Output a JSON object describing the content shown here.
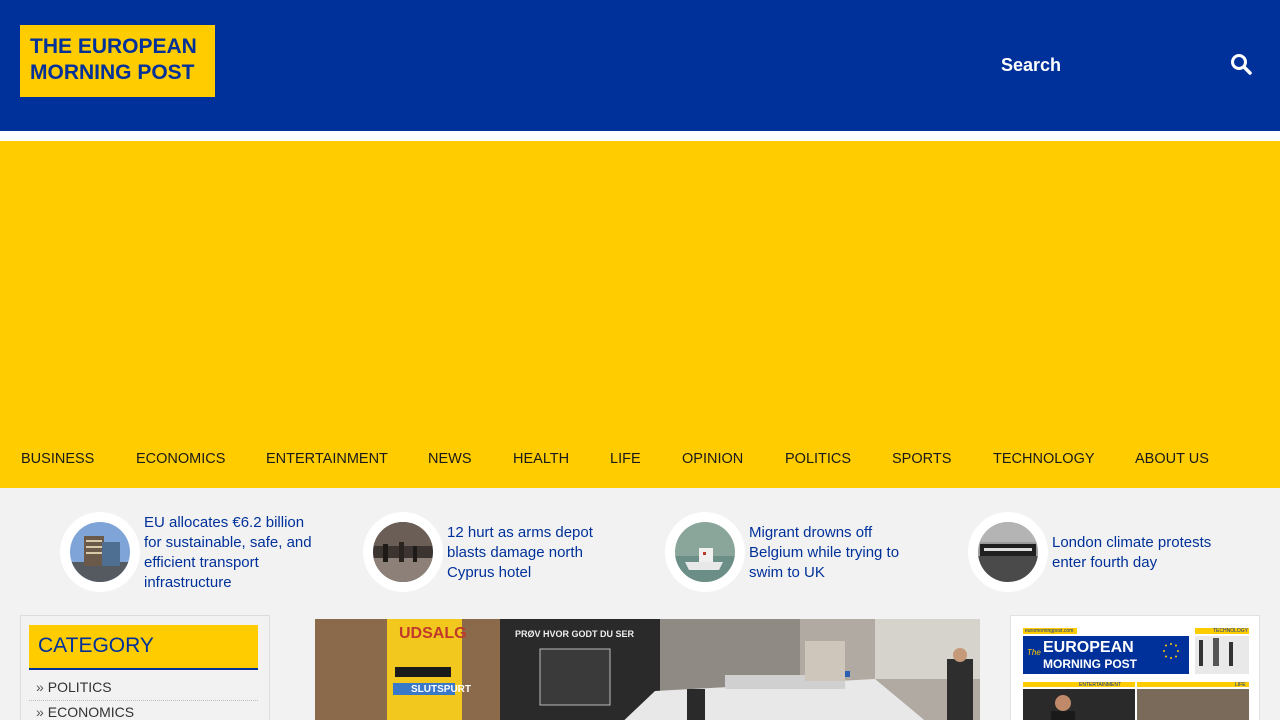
{
  "header": {
    "logo_line1": "THE EUROPEAN",
    "logo_line2": "MORNING POST",
    "search_label": "Search",
    "search_icon": "search-icon",
    "bg_color": "#00319a",
    "accent_color": "#ffcc00"
  },
  "nav": {
    "items": [
      {
        "label": "BUSINESS"
      },
      {
        "label": "ECONOMICS"
      },
      {
        "label": "ENTERTAINMENT"
      },
      {
        "label": "NEWS"
      },
      {
        "label": "HEALTH"
      },
      {
        "label": "LIFE"
      },
      {
        "label": "OPINION"
      },
      {
        "label": "POLITICS"
      },
      {
        "label": "SPORTS"
      },
      {
        "label": "TECHNOLOGY"
      },
      {
        "label": "ABOUT US"
      }
    ]
  },
  "featured": [
    {
      "title": "EU allocates €6.2 billion for sustainable, safe, and efficient transport infrastructure"
    },
    {
      "title": "12 hurt as arms depot blasts damage north Cyprus hotel"
    },
    {
      "title": "Migrant drowns off Belgium while trying to swim to UK"
    },
    {
      "title": "London climate protests enter fourth day"
    }
  ],
  "sidebar": {
    "category_title": "CATEGORY",
    "arrow": "»",
    "items": [
      {
        "label": "POLITICS"
      },
      {
        "label": "ECONOMICS"
      }
    ]
  },
  "main_photo": {
    "sign1": "UDSALG",
    "sign2": "PRØV HVOR GODT DU SER",
    "sign3": "SLUTSPURT"
  },
  "paper_thumb": {
    "site": "euromorningpost.com",
    "tag1": "TECHNOLOGY",
    "brand1": "EUROPEAN",
    "brand2": "MORNING POST",
    "the": "The",
    "tag2": "ENTERTAINMENT",
    "tag3": "LIFE"
  }
}
